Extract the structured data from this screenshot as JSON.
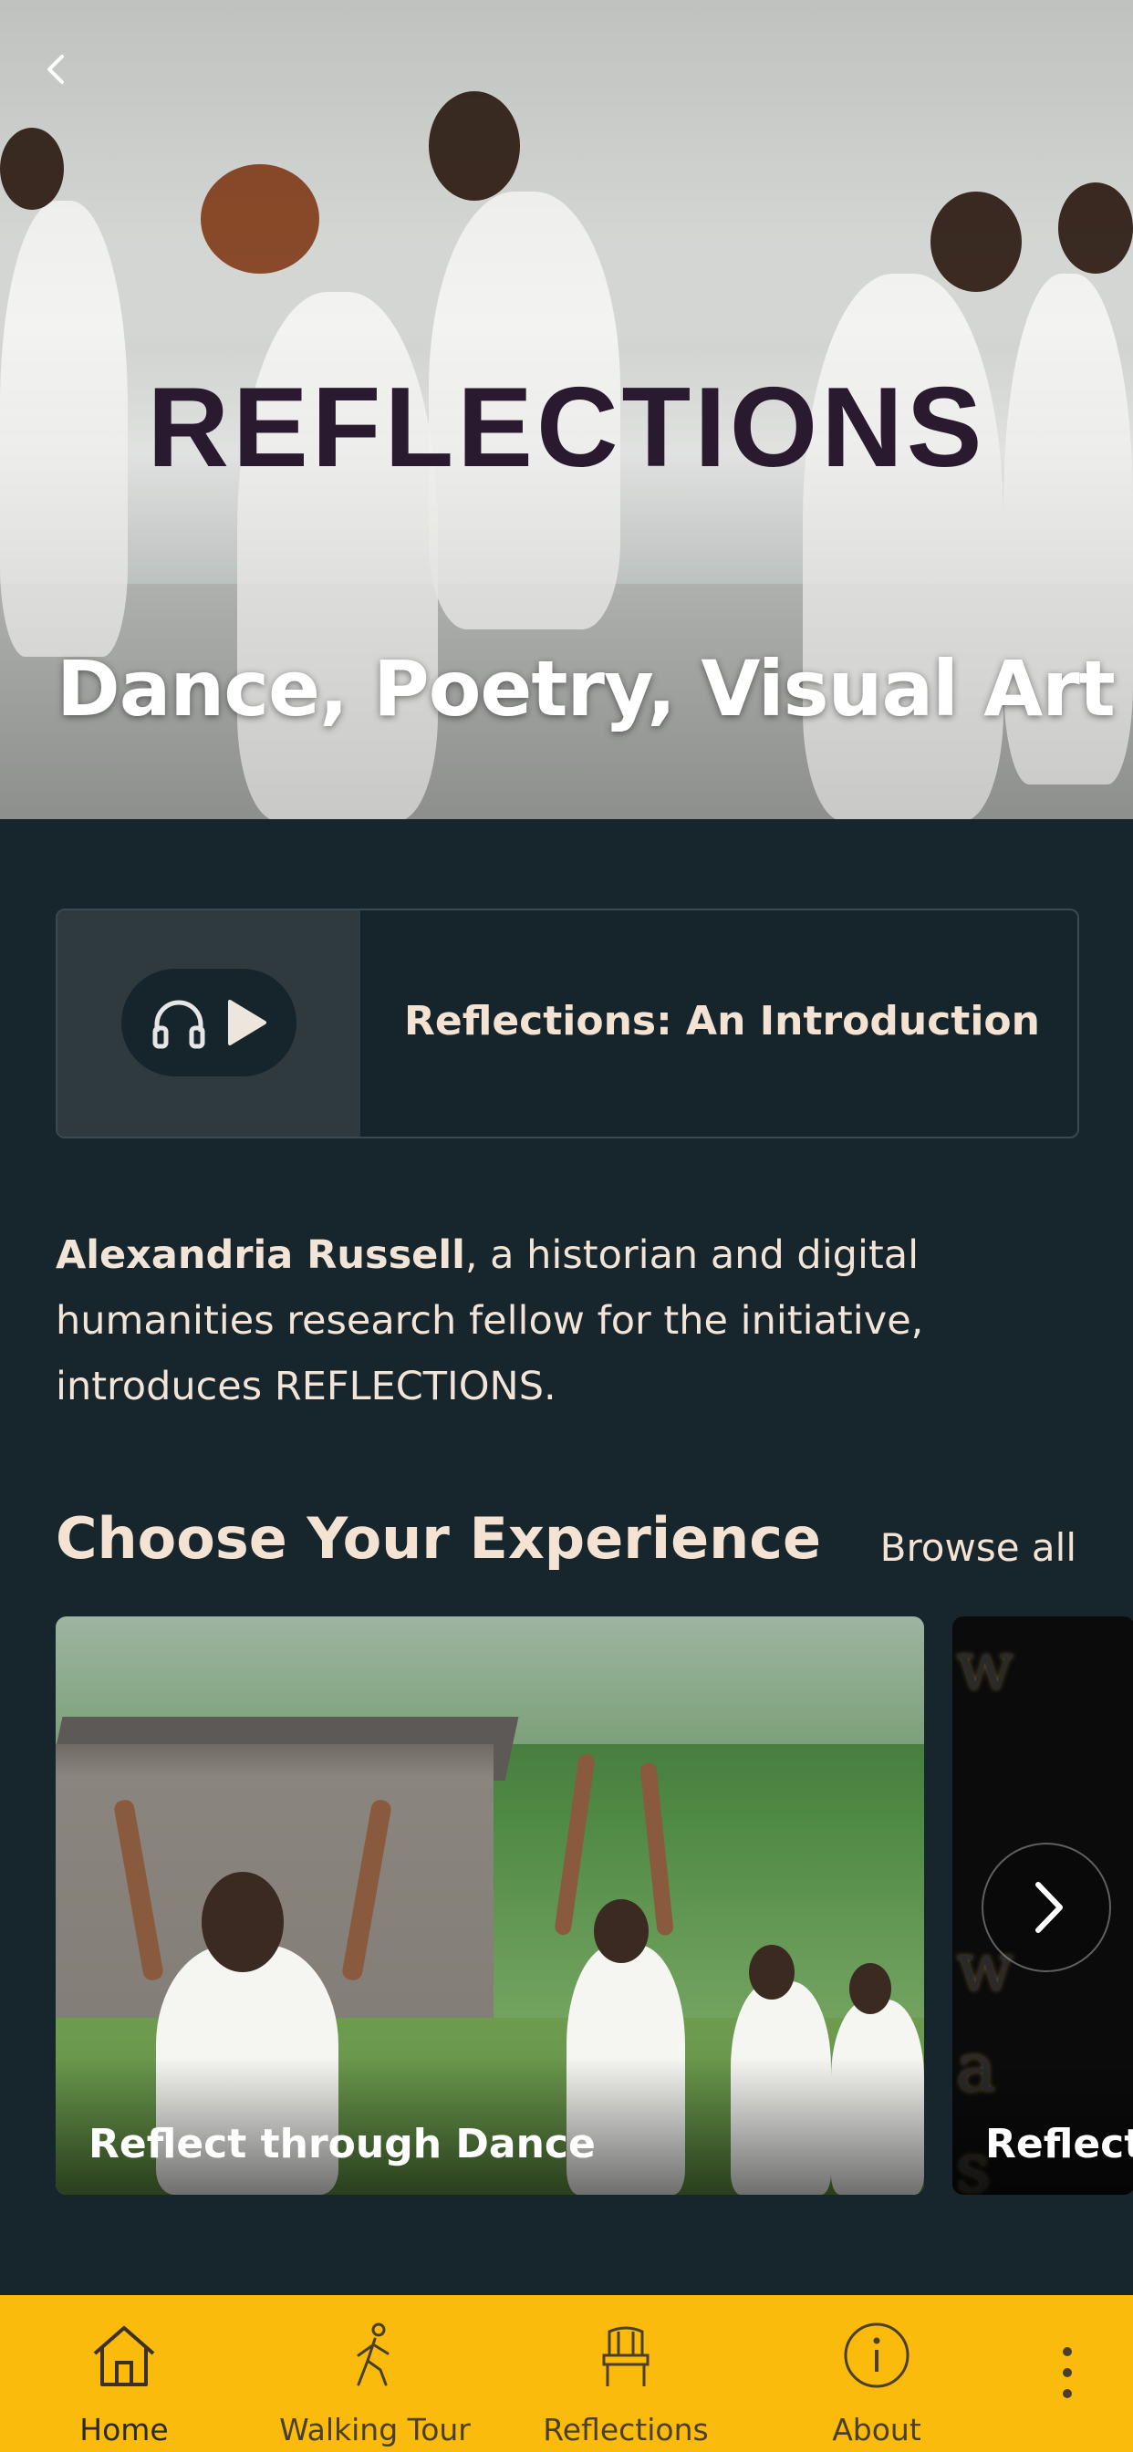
{
  "hero": {
    "logo_text": "REFLECTIONS",
    "title": "Dance, Poetry, Visual Art"
  },
  "audio_card": {
    "title": "Reflections: An Introduction"
  },
  "intro": {
    "name": "Alexandria Russell",
    "text": ", a historian and digital humanities research fellow for the initiative, introduces REFLECTIONS."
  },
  "experiences": {
    "heading": "Choose Your Experience",
    "browse_label": "Browse all",
    "cards": [
      {
        "label": "Reflect through Dance"
      },
      {
        "label": "Reflect"
      }
    ]
  },
  "tabbar": {
    "active_color": "#fbbb0c",
    "items": [
      {
        "label": "Home",
        "icon": "home-icon"
      },
      {
        "label": "Walking Tour",
        "icon": "walking-icon"
      },
      {
        "label": "Reflections",
        "icon": "chair-icon"
      },
      {
        "label": "About",
        "icon": "info-icon"
      }
    ]
  }
}
